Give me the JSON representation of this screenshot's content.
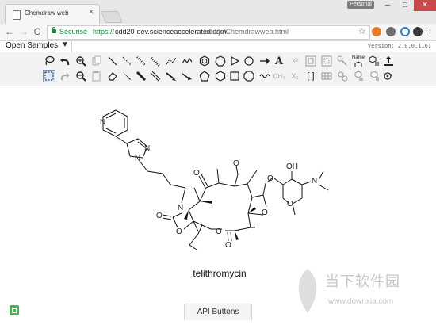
{
  "browser": {
    "tab_title": "Chemdraw web",
    "tab_close": "×",
    "user_chip": "Personal",
    "window_controls": {
      "minimize": "–",
      "maximize": "□",
      "close": "✕"
    },
    "nav": {
      "back": "←",
      "forward": "→",
      "reload": "C"
    },
    "address": {
      "secure_label": "Sécurisé",
      "scheme": "https://",
      "host": "cdd20-dev.scienceaccelerated.com",
      "path": "/cdd/js/Chemdrawweb.html"
    },
    "star": "☆",
    "menu": "⋮",
    "extensions": [
      "orange-extension-icon",
      "gray-extension-icon",
      "blue-ring-extension-icon"
    ]
  },
  "app": {
    "open_samples_label": "Open Samples",
    "open_samples_caret": "▼",
    "version": "Version: 2.0.0.1161"
  },
  "toolbar": {
    "row1": [
      "lasso",
      "undo",
      "zoom-in",
      "copy",
      "single-bond",
      "hashed-bond",
      "wedge-hashed-bond",
      "bold-hashed-bond",
      "chain",
      "cyclohexane",
      "cyclopentane",
      "triangle",
      "circle",
      "arrow",
      "text",
      "superscript",
      "grid",
      "template",
      "stereo",
      "name-to-structure",
      "reaction",
      "clear-tool"
    ],
    "row2": [
      "marquee",
      "redo",
      "zoom-out",
      "paste",
      "eraser",
      "wedge-bond",
      "bold-bond",
      "double-bond",
      "arrow-tool",
      "pentagon",
      "hexagon",
      "rectangle",
      "benzene",
      "chain-ch3",
      "subscript",
      "bracket",
      "chem-tool",
      "compound",
      "periodic",
      "radical"
    ],
    "text": {
      "text_tool": "A",
      "superscript": "X²",
      "subscript": "X₁",
      "bracket": "[ ]",
      "ch3": "CH₃",
      "name": "Name",
      "chain": "⋀⋁"
    }
  },
  "canvas": {
    "molecule_name": "telithromycin",
    "atom_labels": [
      "N",
      "N",
      "N",
      "N",
      "O",
      "O",
      "O",
      "O",
      "O",
      "O",
      "O",
      "O",
      "O",
      "OH",
      "N",
      "O",
      "O"
    ],
    "api_buttons_label": "API Buttons",
    "watermark_text": "当下软件园",
    "watermark_site": "www.downxia.com"
  },
  "colors": {
    "accent": "#1a8a3a",
    "toolbar_bg": "#f3f3f3",
    "selection": "#6f8fbf",
    "trash": "#4caf50"
  }
}
